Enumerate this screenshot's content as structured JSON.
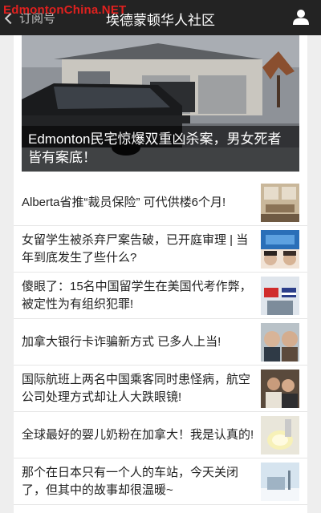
{
  "watermark": "EdmontonChina.NET",
  "header": {
    "back_label": "订阅号",
    "title": "埃德蒙顿华人社区"
  },
  "hero": {
    "caption": "Edmonton民宅惊爆双重凶杀案，男女死者皆有案底！"
  },
  "articles": [
    {
      "title": "Alberta省推“裁员保险” 可代供楼6个月!"
    },
    {
      "title": "女留学生被杀弃尸案告破，已开庭审理 | 当年到底发生了些什么?"
    },
    {
      "title": "傻眼了：15名中国留学生在美国代考作弊，被定性为有组织犯罪!"
    },
    {
      "title": "加拿大银行卡诈骗新方式 已多人上当!"
    },
    {
      "title": "国际航班上两名中国乘客同时患怪病，航空公司处理方式却让人大跌眼镜!"
    },
    {
      "title": "全球最好的婴儿奶粉在加拿大！我是认真的!"
    },
    {
      "title": "那个在日本只有一个人的车站，今天关闭了，但其中的故事却很温暖~"
    }
  ],
  "colors": {
    "topbar": "#232323",
    "watermark": "#e0211f",
    "background": "#eeeeee"
  }
}
